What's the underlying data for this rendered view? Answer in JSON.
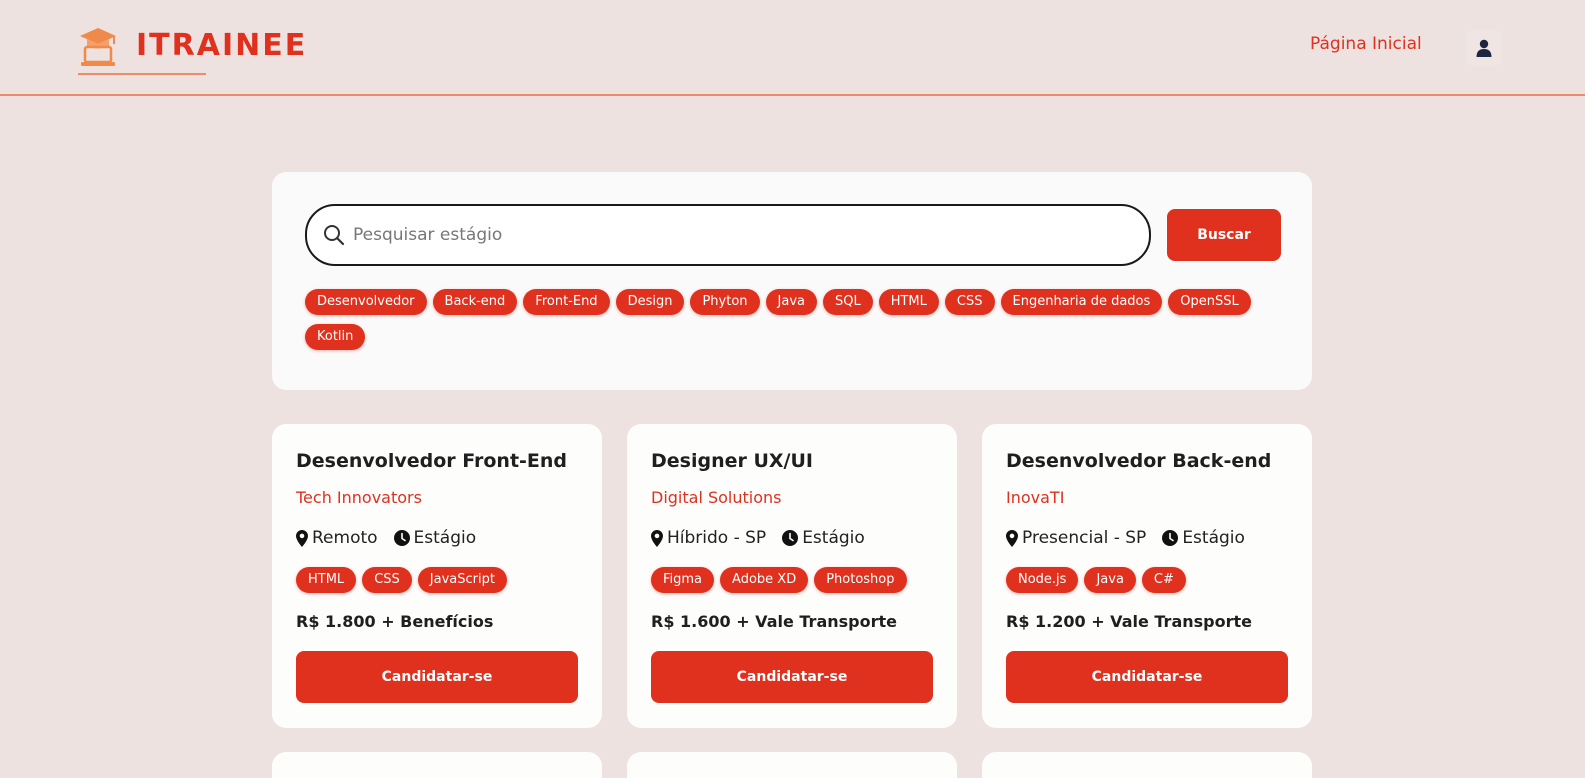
{
  "header": {
    "brand": "ITRAINEE",
    "nav_home": "Página Inicial",
    "user_icon": "user-icon",
    "logo_icon": "laptop-graduation-cap-icon"
  },
  "search": {
    "placeholder": "Pesquisar estágio",
    "value": "",
    "button_label": "Buscar",
    "tags": [
      "Desenvolvedor",
      "Back-end",
      "Front-End",
      "Design",
      "Phyton",
      "Java",
      "SQL",
      "HTML",
      "CSS",
      "Engenharia de dados",
      "OpenSSL",
      "Kotlin"
    ]
  },
  "jobs": [
    {
      "title": "Desenvolvedor Front-End",
      "company": "Tech Innovators",
      "location": "Remoto",
      "type": "Estágio",
      "skills": [
        "HTML",
        "CSS",
        "JavaScript"
      ],
      "salary": "R$ 1.800 + Benefícios",
      "apply_label": "Candidatar-se"
    },
    {
      "title": "Designer UX/UI",
      "company": "Digital Solutions",
      "location": "Híbrido - SP",
      "type": "Estágio",
      "skills": [
        "Figma",
        "Adobe XD",
        "Photoshop"
      ],
      "salary": "R$ 1.600 + Vale Transporte",
      "apply_label": "Candidatar-se"
    },
    {
      "title": "Desenvolvedor Back-end",
      "company": "InovaTI",
      "location": "Presencial - SP",
      "type": "Estágio",
      "skills": [
        "Node.js",
        "Java",
        "C#"
      ],
      "salary": "R$ 1.200 + Vale Transporte",
      "apply_label": "Candidatar-se"
    }
  ],
  "colors": {
    "accent": "#e0301e",
    "background": "#ede2e0",
    "header_border": "#f08a6a",
    "panel": "#fafafa"
  }
}
